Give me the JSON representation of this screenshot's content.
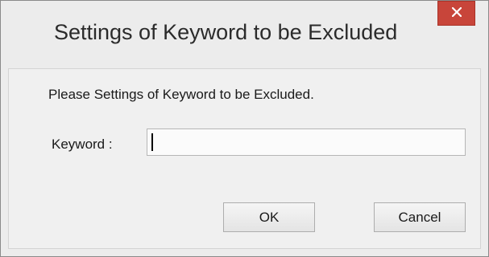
{
  "dialog": {
    "title": "Settings of Keyword to be Excluded",
    "prompt": "Please Settings of Keyword to be Excluded.",
    "keyword_label": "Keyword  :",
    "keyword_value": "",
    "ok_label": "OK",
    "cancel_label": "Cancel"
  },
  "icons": {
    "close": "close-icon"
  },
  "colors": {
    "close_button": "#c8453a",
    "window_background": "#ececec"
  }
}
